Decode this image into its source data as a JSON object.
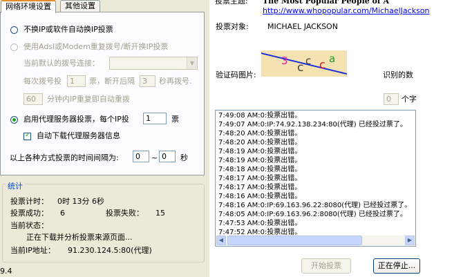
{
  "tabs": [
    {
      "label": "网络环境设置",
      "active": true
    },
    {
      "label": "其他设置",
      "active": false
    }
  ],
  "network": {
    "opt_no_switch": "不换IP或软件自动换IP投票",
    "opt_adsl": "使用Adsl或Modem重复拨号/断开换IP投票",
    "dial_label": "当前默认的拨号连接：",
    "dial_every_prefix": "每次拨号投",
    "dial_every_value": "1",
    "dial_votes_suffix": "票，断开后隔",
    "dial_wait_value": "3",
    "dial_wait_suffix": "秒再拨号.",
    "repeat_value": "60",
    "repeat_suffix": "分钟内IP重复即自动重拨",
    "opt_proxy": "启用代理服务器投票，每个IP投",
    "proxy_votes_value": "1",
    "proxy_votes_suffix": "票",
    "auto_download": "自动下载代理服务器信息",
    "interval_label": "以上各种方式投票的时间间隔为:",
    "interval_min": "0",
    "interval_sep": "~",
    "interval_max": "0",
    "interval_unit": "秒"
  },
  "stats": {
    "title": "统计",
    "timer_label": "投票计时：",
    "timer_value": "0时 13分 6秒",
    "success_label": "投票成功：",
    "success_value": "6",
    "fail_label": "投票失败：",
    "fail_value": "15",
    "status_label": "当前状态：",
    "status_value": "正在下载并分析投票来源页面...",
    "ip_label": "当前IP地址：",
    "ip_value": "91.230.124.5:80(代理)"
  },
  "version": "9.4",
  "vote": {
    "theme_label": "投票主题:",
    "theme_value": "The Most Popular People of A",
    "link": "http://www.whopopular.com/MichaelJackson",
    "target_label": "投票对象:",
    "target_value": "MICHAEL JACKSON",
    "captcha_label": "验证码图片:",
    "captcha_chars": [
      "3",
      "c",
      "c",
      "c",
      "a"
    ],
    "recognized_label": "识别的数",
    "recognized_value": "0",
    "recognized_suffix": "个字"
  },
  "log": [
    "7:49:08 AM:0:投票出错。",
    "7:49:07 AM:0:IP:74.92.138.234:80(代理) 已经投过票了。",
    "7:48:20 AM:0:投票出错。",
    "7:48:20 AM:0:投票出错。",
    "7:48:19 AM:0:投票出错。",
    "7:48:19 AM:0:投票出错。",
    "7:48:18 AM:0:投票出错。",
    "7:48:17 AM:0:投票出错。",
    "7:48:17 AM:0:投票出错。",
    "7:48:16 AM:0:投票出错。",
    "7:48:16 AM:0:IP:69.163.96.22:8080(代理) 已经投过票了。",
    "7:48:05 AM:0:IP:69.163.96.2:8080(代理) 已经投过票了。",
    "7:47:53 AM:0:投票出错。",
    "7:47:52 AM:0:投票出错。"
  ],
  "buttons": {
    "start": "开始投票",
    "stop": "正在停止..."
  },
  "colors": {
    "accent_tab": "#e68b2c",
    "group_title": "#0046d5",
    "link": "#0000ff",
    "radio_dot": "#21a121"
  }
}
